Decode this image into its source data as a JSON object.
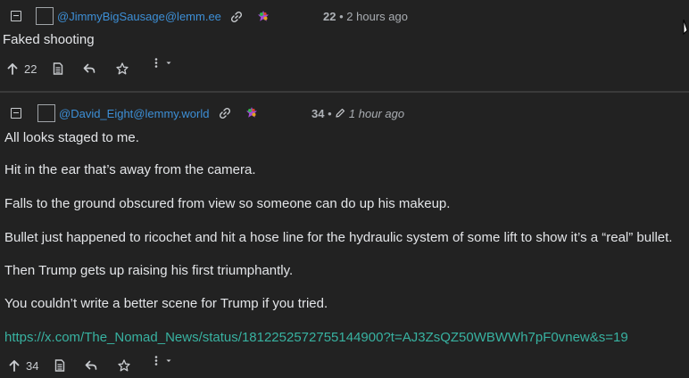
{
  "comments": [
    {
      "username": "@JimmyBigSausage@lemm.ee",
      "score": "22",
      "separator": "•",
      "time": "2 hours ago",
      "body": [
        "Faked shooting"
      ],
      "actions": {
        "upvote_count": "22"
      }
    },
    {
      "username": "@David_Eight@lemmy.world",
      "score": "34",
      "separator": "•",
      "time": "1 hour ago",
      "edited": true,
      "body": [
        "All looks staged to me.",
        "Hit in the ear that’s away from the camera.",
        "Falls to the ground obscured from view so someone can do up his makeup.",
        "Bullet just happened to ricochet and hit a hose line for the hydraulic system of some lift to show it’s a “real” bullet.",
        "Then Trump gets up raising his first triumphantly.",
        "You couldn’t write a better scene for Trump if you tried."
      ],
      "link": "https://x.com/The_Nomad_News/status/1812252572755144900?t=AJ3ZsQZ50WBWWh7pF0vnew&s=19",
      "actions": {
        "upvote_count": "34"
      }
    }
  ],
  "colors": {
    "background": "#222222",
    "username": "#3d8fd6",
    "link": "#38b2a1",
    "meta": "#a9adb2"
  },
  "icons": [
    "collapse-icon",
    "avatar",
    "copy-link-icon",
    "instance-badge-icon",
    "upvote-icon",
    "view-source-icon",
    "reply-icon",
    "save-icon",
    "more-options-icon",
    "edit-pencil-icon",
    "cursor-icon"
  ]
}
